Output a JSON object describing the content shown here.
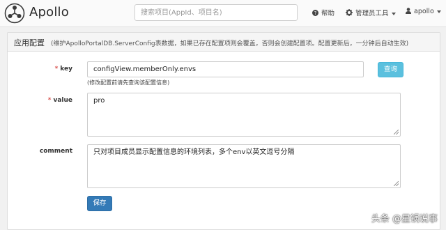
{
  "navbar": {
    "brand": "Apollo",
    "search_placeholder": "搜索项目(AppId、项目名)",
    "help_label": "帮助",
    "admin_tools_label": "管理员工具",
    "user_label": "apollo"
  },
  "panel": {
    "title": "应用配置",
    "subtitle": "(维护ApolloPortalDB.ServerConfig表数据，如果已存在配置项则会覆盖，否则会创建配置项。配置更新后，一分钟后自动生效)"
  },
  "form": {
    "key_label": "key",
    "key_value": "configView.memberOnly.envs",
    "key_hint": "(修改配置前请先查询该配置信息)",
    "query_button": "查询",
    "value_label": "value",
    "value_value": "pro",
    "comment_label": "comment",
    "comment_value": "只对项目成员显示配置信息的环境列表，多个env以英文逗号分隔",
    "save_button": "保存"
  },
  "watermark": "头条 @星锅说事",
  "icons": {
    "logo": "apollo-logo-icon",
    "help": "question-circle-icon",
    "admin": "gear-icon",
    "user": "user-icon",
    "dropdown": "caret-down-icon"
  },
  "colors": {
    "required_star": "#d9534f",
    "query_button": "#5bc0de",
    "save_button": "#337ab7"
  }
}
